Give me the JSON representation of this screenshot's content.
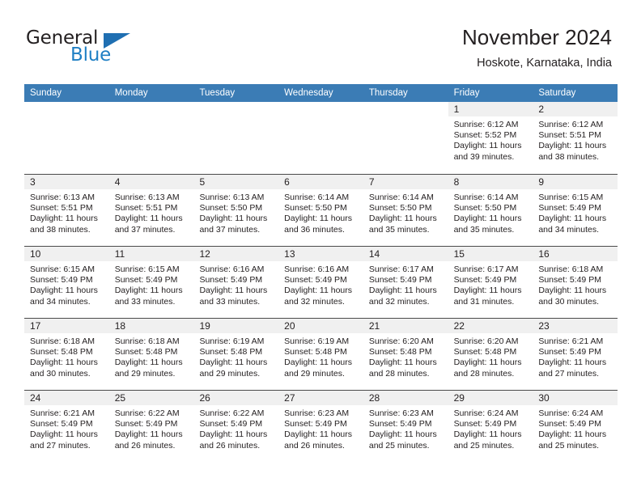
{
  "brand": {
    "name_part1": "General",
    "name_part2": "Blue",
    "triangle_color": "#1f6fb2",
    "blue_color": "#1f7fc4"
  },
  "header": {
    "title": "November 2024",
    "location": "Hoskote, Karnataka, India",
    "header_bg": "#3b7cb5",
    "daynum_band_bg": "#f0f0f0"
  },
  "weekdays": [
    "Sunday",
    "Monday",
    "Tuesday",
    "Wednesday",
    "Thursday",
    "Friday",
    "Saturday"
  ],
  "weeks": [
    [
      {
        "day": "",
        "sunrise": "",
        "sunset": "",
        "daylight1": "",
        "daylight2": "",
        "empty": true
      },
      {
        "day": "",
        "sunrise": "",
        "sunset": "",
        "daylight1": "",
        "daylight2": "",
        "empty": true
      },
      {
        "day": "",
        "sunrise": "",
        "sunset": "",
        "daylight1": "",
        "daylight2": "",
        "empty": true
      },
      {
        "day": "",
        "sunrise": "",
        "sunset": "",
        "daylight1": "",
        "daylight2": "",
        "empty": true
      },
      {
        "day": "",
        "sunrise": "",
        "sunset": "",
        "daylight1": "",
        "daylight2": "",
        "empty": true
      },
      {
        "day": "1",
        "sunrise": "Sunrise: 6:12 AM",
        "sunset": "Sunset: 5:52 PM",
        "daylight1": "Daylight: 11 hours",
        "daylight2": "and 39 minutes."
      },
      {
        "day": "2",
        "sunrise": "Sunrise: 6:12 AM",
        "sunset": "Sunset: 5:51 PM",
        "daylight1": "Daylight: 11 hours",
        "daylight2": "and 38 minutes."
      }
    ],
    [
      {
        "day": "3",
        "sunrise": "Sunrise: 6:13 AM",
        "sunset": "Sunset: 5:51 PM",
        "daylight1": "Daylight: 11 hours",
        "daylight2": "and 38 minutes."
      },
      {
        "day": "4",
        "sunrise": "Sunrise: 6:13 AM",
        "sunset": "Sunset: 5:51 PM",
        "daylight1": "Daylight: 11 hours",
        "daylight2": "and 37 minutes."
      },
      {
        "day": "5",
        "sunrise": "Sunrise: 6:13 AM",
        "sunset": "Sunset: 5:50 PM",
        "daylight1": "Daylight: 11 hours",
        "daylight2": "and 37 minutes."
      },
      {
        "day": "6",
        "sunrise": "Sunrise: 6:14 AM",
        "sunset": "Sunset: 5:50 PM",
        "daylight1": "Daylight: 11 hours",
        "daylight2": "and 36 minutes."
      },
      {
        "day": "7",
        "sunrise": "Sunrise: 6:14 AM",
        "sunset": "Sunset: 5:50 PM",
        "daylight1": "Daylight: 11 hours",
        "daylight2": "and 35 minutes."
      },
      {
        "day": "8",
        "sunrise": "Sunrise: 6:14 AM",
        "sunset": "Sunset: 5:50 PM",
        "daylight1": "Daylight: 11 hours",
        "daylight2": "and 35 minutes."
      },
      {
        "day": "9",
        "sunrise": "Sunrise: 6:15 AM",
        "sunset": "Sunset: 5:49 PM",
        "daylight1": "Daylight: 11 hours",
        "daylight2": "and 34 minutes."
      }
    ],
    [
      {
        "day": "10",
        "sunrise": "Sunrise: 6:15 AM",
        "sunset": "Sunset: 5:49 PM",
        "daylight1": "Daylight: 11 hours",
        "daylight2": "and 34 minutes."
      },
      {
        "day": "11",
        "sunrise": "Sunrise: 6:15 AM",
        "sunset": "Sunset: 5:49 PM",
        "daylight1": "Daylight: 11 hours",
        "daylight2": "and 33 minutes."
      },
      {
        "day": "12",
        "sunrise": "Sunrise: 6:16 AM",
        "sunset": "Sunset: 5:49 PM",
        "daylight1": "Daylight: 11 hours",
        "daylight2": "and 33 minutes."
      },
      {
        "day": "13",
        "sunrise": "Sunrise: 6:16 AM",
        "sunset": "Sunset: 5:49 PM",
        "daylight1": "Daylight: 11 hours",
        "daylight2": "and 32 minutes."
      },
      {
        "day": "14",
        "sunrise": "Sunrise: 6:17 AM",
        "sunset": "Sunset: 5:49 PM",
        "daylight1": "Daylight: 11 hours",
        "daylight2": "and 32 minutes."
      },
      {
        "day": "15",
        "sunrise": "Sunrise: 6:17 AM",
        "sunset": "Sunset: 5:49 PM",
        "daylight1": "Daylight: 11 hours",
        "daylight2": "and 31 minutes."
      },
      {
        "day": "16",
        "sunrise": "Sunrise: 6:18 AM",
        "sunset": "Sunset: 5:49 PM",
        "daylight1": "Daylight: 11 hours",
        "daylight2": "and 30 minutes."
      }
    ],
    [
      {
        "day": "17",
        "sunrise": "Sunrise: 6:18 AM",
        "sunset": "Sunset: 5:48 PM",
        "daylight1": "Daylight: 11 hours",
        "daylight2": "and 30 minutes."
      },
      {
        "day": "18",
        "sunrise": "Sunrise: 6:18 AM",
        "sunset": "Sunset: 5:48 PM",
        "daylight1": "Daylight: 11 hours",
        "daylight2": "and 29 minutes."
      },
      {
        "day": "19",
        "sunrise": "Sunrise: 6:19 AM",
        "sunset": "Sunset: 5:48 PM",
        "daylight1": "Daylight: 11 hours",
        "daylight2": "and 29 minutes."
      },
      {
        "day": "20",
        "sunrise": "Sunrise: 6:19 AM",
        "sunset": "Sunset: 5:48 PM",
        "daylight1": "Daylight: 11 hours",
        "daylight2": "and 29 minutes."
      },
      {
        "day": "21",
        "sunrise": "Sunrise: 6:20 AM",
        "sunset": "Sunset: 5:48 PM",
        "daylight1": "Daylight: 11 hours",
        "daylight2": "and 28 minutes."
      },
      {
        "day": "22",
        "sunrise": "Sunrise: 6:20 AM",
        "sunset": "Sunset: 5:48 PM",
        "daylight1": "Daylight: 11 hours",
        "daylight2": "and 28 minutes."
      },
      {
        "day": "23",
        "sunrise": "Sunrise: 6:21 AM",
        "sunset": "Sunset: 5:49 PM",
        "daylight1": "Daylight: 11 hours",
        "daylight2": "and 27 minutes."
      }
    ],
    [
      {
        "day": "24",
        "sunrise": "Sunrise: 6:21 AM",
        "sunset": "Sunset: 5:49 PM",
        "daylight1": "Daylight: 11 hours",
        "daylight2": "and 27 minutes."
      },
      {
        "day": "25",
        "sunrise": "Sunrise: 6:22 AM",
        "sunset": "Sunset: 5:49 PM",
        "daylight1": "Daylight: 11 hours",
        "daylight2": "and 26 minutes."
      },
      {
        "day": "26",
        "sunrise": "Sunrise: 6:22 AM",
        "sunset": "Sunset: 5:49 PM",
        "daylight1": "Daylight: 11 hours",
        "daylight2": "and 26 minutes."
      },
      {
        "day": "27",
        "sunrise": "Sunrise: 6:23 AM",
        "sunset": "Sunset: 5:49 PM",
        "daylight1": "Daylight: 11 hours",
        "daylight2": "and 26 minutes."
      },
      {
        "day": "28",
        "sunrise": "Sunrise: 6:23 AM",
        "sunset": "Sunset: 5:49 PM",
        "daylight1": "Daylight: 11 hours",
        "daylight2": "and 25 minutes."
      },
      {
        "day": "29",
        "sunrise": "Sunrise: 6:24 AM",
        "sunset": "Sunset: 5:49 PM",
        "daylight1": "Daylight: 11 hours",
        "daylight2": "and 25 minutes."
      },
      {
        "day": "30",
        "sunrise": "Sunrise: 6:24 AM",
        "sunset": "Sunset: 5:49 PM",
        "daylight1": "Daylight: 11 hours",
        "daylight2": "and 25 minutes."
      }
    ]
  ]
}
